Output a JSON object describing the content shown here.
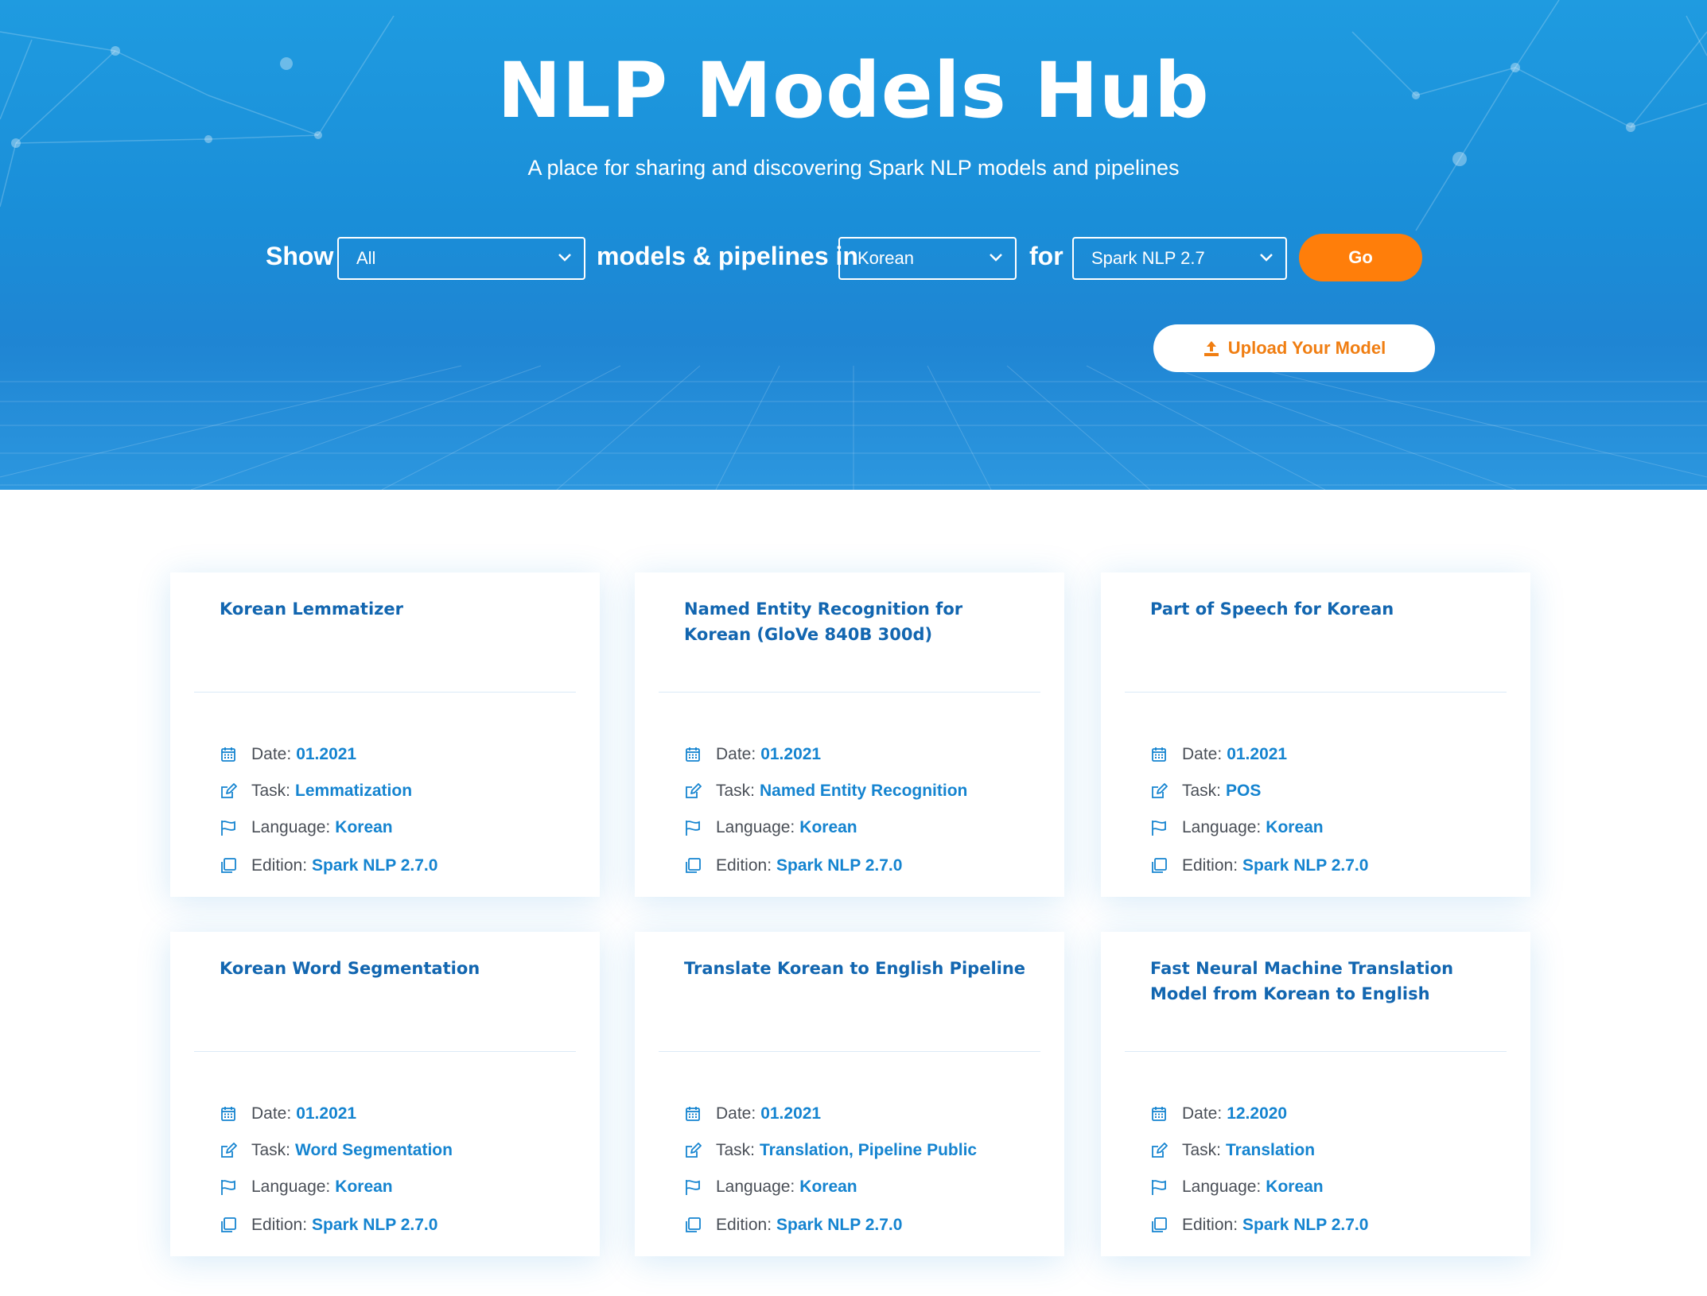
{
  "hero": {
    "title": "NLP Models Hub",
    "subtitle": "A place for sharing and discovering Spark NLP models and pipelines"
  },
  "filter": {
    "show_label": "Show",
    "type_select": "All",
    "in_label": "models & pipelines in",
    "language_select": "Korean",
    "for_label": "for",
    "edition_select": "Spark NLP 2.7",
    "go_label": "Go"
  },
  "upload": {
    "label": "Upload Your Model",
    "icon": "upload-icon"
  },
  "meta_labels": {
    "date": "Date:",
    "task": "Task:",
    "language": "Language:",
    "edition": "Edition:"
  },
  "cards": [
    {
      "title": "Korean Lemmatizer",
      "date": "01.2021",
      "task": "Lemmatization",
      "language": "Korean",
      "edition": "Spark NLP 2.7.0"
    },
    {
      "title": "Named Entity Recognition for Korean (GloVe 840B 300d)",
      "date": "01.2021",
      "task": "Named Entity Recognition",
      "language": "Korean",
      "edition": "Spark NLP 2.7.0"
    },
    {
      "title": "Part of Speech for Korean",
      "date": "01.2021",
      "task": "POS",
      "language": "Korean",
      "edition": "Spark NLP 2.7.0"
    },
    {
      "title": "Korean Word Segmentation",
      "date": "01.2021",
      "task": "Word Segmentation",
      "language": "Korean",
      "edition": "Spark NLP 2.7.0"
    },
    {
      "title": "Translate Korean to English Pipeline",
      "date": "01.2021",
      "task": "Translation, Pipeline Public",
      "language": "Korean",
      "edition": "Spark NLP 2.7.0"
    },
    {
      "title": "Fast Neural Machine Translation Model from Korean to English",
      "date": "12.2020",
      "task": "Translation",
      "language": "Korean",
      "edition": "Spark NLP 2.7.0"
    }
  ],
  "colors": {
    "accent": "#1584d0",
    "title": "#1266b0",
    "orange": "#ff7e0a",
    "hero": "#1f95dc"
  }
}
